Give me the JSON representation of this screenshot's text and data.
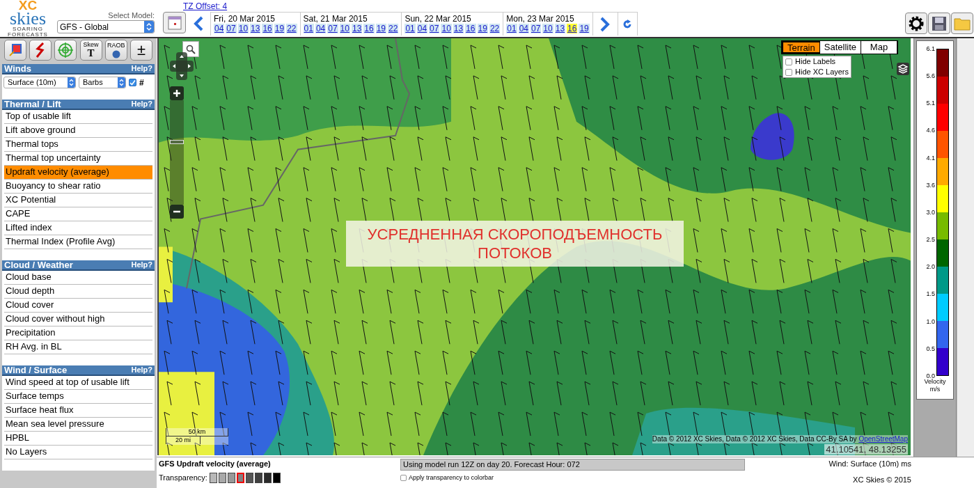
{
  "logo": {
    "top": "XC",
    "main": "skies",
    "sub": [
      "SOARING",
      "FORECASTS"
    ]
  },
  "model": {
    "label": "Select Model:",
    "value": "GFS - Global"
  },
  "tz_offset": "TZ Offset: 4",
  "days": [
    {
      "label": "Fri, 20 Mar 2015",
      "hours": [
        {
          "text": "04",
          "selected": false
        },
        {
          "text": "07",
          "selected": false
        },
        {
          "text": "10",
          "selected": false
        },
        {
          "text": "13",
          "selected": false
        },
        {
          "text": "16",
          "selected": false
        },
        {
          "text": "19",
          "selected": false
        },
        {
          "text": "22",
          "selected": false
        }
      ]
    },
    {
      "label": "Sat, 21 Mar 2015",
      "hours": [
        {
          "text": "01",
          "selected": false
        },
        {
          "text": "04",
          "selected": false
        },
        {
          "text": "07",
          "selected": false
        },
        {
          "text": "10",
          "selected": false
        },
        {
          "text": "13",
          "selected": false
        },
        {
          "text": "16",
          "selected": false
        },
        {
          "text": "19",
          "selected": false
        },
        {
          "text": "22",
          "selected": false
        }
      ]
    },
    {
      "label": "Sun, 22 Mar 2015",
      "hours": [
        {
          "text": "01",
          "selected": false
        },
        {
          "text": "04",
          "selected": false
        },
        {
          "text": "07",
          "selected": false
        },
        {
          "text": "10",
          "selected": false
        },
        {
          "text": "13",
          "selected": false
        },
        {
          "text": "16",
          "selected": false
        },
        {
          "text": "19",
          "selected": false
        },
        {
          "text": "22",
          "selected": false
        }
      ]
    },
    {
      "label": "Mon, 23 Mar 2015",
      "hours": [
        {
          "text": "01",
          "selected": false
        },
        {
          "text": "04",
          "selected": false
        },
        {
          "text": "07",
          "selected": false
        },
        {
          "text": "10",
          "selected": false
        },
        {
          "text": "13",
          "selected": false
        },
        {
          "text": "16",
          "selected": true
        },
        {
          "text": "19",
          "selected": false
        }
      ]
    }
  ],
  "tools": [
    {
      "kind": "image"
    },
    {
      "kind": "lightning"
    },
    {
      "kind": "target"
    },
    {
      "kind": "skewt",
      "label": "Skew",
      "sub": "T"
    },
    {
      "kind": "raob",
      "label": "RAOB"
    },
    {
      "kind": "plusminus",
      "label": "±"
    }
  ],
  "winds": {
    "title": "Winds",
    "help": "Help?",
    "level": "Surface (10m)",
    "style": "Barbs",
    "grid_checked": true,
    "grid_label": "#"
  },
  "sections": [
    {
      "title": "Thermal / Lift",
      "help": "Help?",
      "items": [
        {
          "label": "Top of usable lift",
          "selected": false
        },
        {
          "label": "Lift above ground",
          "selected": false
        },
        {
          "label": "Thermal tops",
          "selected": false
        },
        {
          "label": "Thermal top uncertainty",
          "selected": false
        },
        {
          "label": "Updraft velocity (average)",
          "selected": true
        },
        {
          "label": "Buoyancy to shear ratio",
          "selected": false
        },
        {
          "label": "XC Potential",
          "selected": false
        },
        {
          "label": "CAPE",
          "selected": false
        },
        {
          "label": "Lifted index",
          "selected": false
        },
        {
          "label": "Thermal Index (Profile Avg)",
          "selected": false
        }
      ]
    },
    {
      "title": "Cloud / Weather",
      "help": "Help?",
      "items": [
        {
          "label": "Cloud base",
          "selected": false
        },
        {
          "label": "Cloud depth",
          "selected": false
        },
        {
          "label": "Cloud cover",
          "selected": false
        },
        {
          "label": "Cloud cover without high",
          "selected": false
        },
        {
          "label": "Precipitation",
          "selected": false
        },
        {
          "label": "RH Avg. in BL",
          "selected": false
        }
      ]
    },
    {
      "title": "Wind / Surface",
      "help": "Help?",
      "items": [
        {
          "label": "Wind speed at top of usable lift",
          "selected": false
        },
        {
          "label": "Surface temps",
          "selected": false
        },
        {
          "label": "Surface heat flux",
          "selected": false
        },
        {
          "label": "Mean sea level pressure",
          "selected": false
        },
        {
          "label": "HPBL",
          "selected": false
        },
        {
          "label": "No Layers",
          "selected": false
        }
      ]
    }
  ],
  "map": {
    "zoom": {
      "level": 0.6
    },
    "base_layers": [
      {
        "label": "Terrain",
        "selected": true
      },
      {
        "label": "Satellite",
        "selected": false
      },
      {
        "label": "Map",
        "selected": false
      }
    ],
    "options": [
      {
        "label": "Hide Labels",
        "checked": false
      },
      {
        "label": "Hide XC Layers",
        "checked": false
      }
    ],
    "overlay_title": [
      "УСРЕДНЕННАЯ СКОРОПОДЪЕМНОСТЬ",
      "ПОТОКОВ"
    ],
    "scale": {
      "metric": "50 km",
      "imperial": "20 mi"
    },
    "attribution": "Data © 2012 XC Skies, Data © 2012 XC Skies, Data CC-By SA by ",
    "attribution_link": "OpenStreetMap",
    "coordinates": "41.10541, 48.13255"
  },
  "legend": {
    "labels": [
      "6.1",
      "5.6",
      "5.1",
      "4.6",
      "4.1",
      "3.6",
      "3.0",
      "2.5",
      "2.0",
      "1.5",
      "1.0",
      "0.5",
      "0.0"
    ],
    "bands": [
      {
        "color": "#800000"
      },
      {
        "color": "#cc0000"
      },
      {
        "color": "#ff0000"
      },
      {
        "color": "#ff5500"
      },
      {
        "color": "#ffaa00"
      },
      {
        "color": "#ffff00"
      },
      {
        "color": "#77bb00"
      },
      {
        "color": "#006600"
      },
      {
        "color": "#009988"
      },
      {
        "color": "#00ccff"
      },
      {
        "color": "#3366ee"
      },
      {
        "color": "#3300cc"
      }
    ],
    "title": "Velocity",
    "unit": "m/s"
  },
  "footer": {
    "layer_name": "GFS Updraft velocity (average)",
    "transparency_label": "Transparency:",
    "transparency": [
      {
        "color": "#b8b8b8",
        "selected": false
      },
      {
        "color": "#a8a8a8",
        "selected": false
      },
      {
        "color": "#989898",
        "selected": false
      },
      {
        "color": "#808080",
        "selected": true
      },
      {
        "color": "#555555",
        "selected": false
      },
      {
        "color": "#404040",
        "selected": false
      },
      {
        "color": "#2a2a2a",
        "selected": false
      },
      {
        "color": "#000000",
        "selected": false
      }
    ],
    "status": "Using model run 12Z on day 20. Forecast Hour: 072",
    "apply_label": "Apply transparency to colorbar",
    "apply_checked": false,
    "wind": "Wind: Surface (10m) ms",
    "copyright": "XC Skies © 2015"
  }
}
